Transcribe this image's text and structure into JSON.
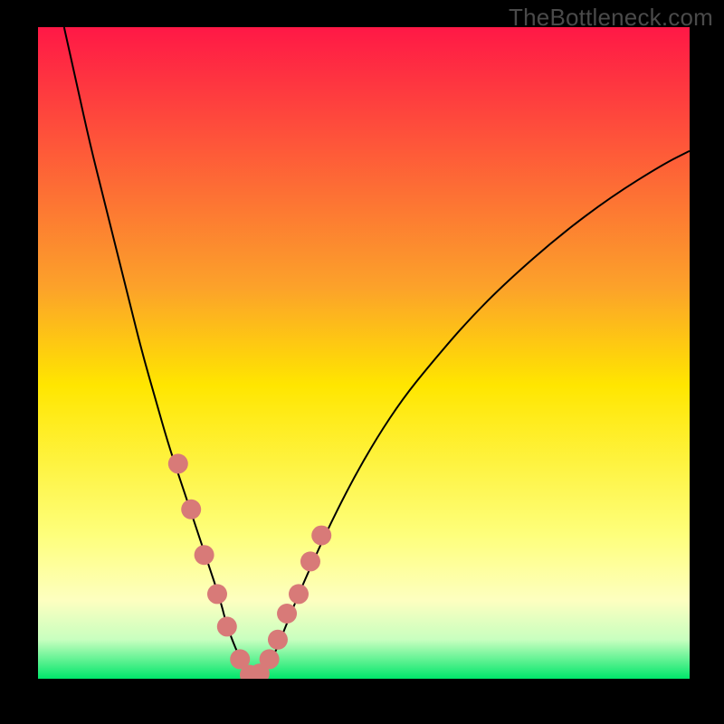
{
  "watermark": "TheBottleneck.com",
  "chart_data": {
    "type": "line",
    "title": "",
    "xlabel": "",
    "ylabel": "",
    "xlim": [
      0,
      100
    ],
    "ylim": [
      0,
      100
    ],
    "background_gradient": {
      "stops": [
        {
          "offset": 0.0,
          "color": "#ff1846"
        },
        {
          "offset": 0.4,
          "color": "#fca22a"
        },
        {
          "offset": 0.55,
          "color": "#ffe600"
        },
        {
          "offset": 0.78,
          "color": "#feff7c"
        },
        {
          "offset": 0.88,
          "color": "#fdffc0"
        },
        {
          "offset": 0.94,
          "color": "#c8ffbf"
        },
        {
          "offset": 1.0,
          "color": "#00e66a"
        }
      ]
    },
    "series": [
      {
        "name": "bottleneck-curve",
        "stroke": "#000000",
        "stroke_width": 2,
        "x": [
          4,
          6,
          8,
          10,
          12,
          14,
          16,
          18,
          20,
          22,
          24,
          26,
          28,
          29,
          31,
          32.5,
          34,
          36,
          38,
          40,
          44,
          48,
          52,
          56,
          60,
          66,
          72,
          80,
          88,
          96,
          100
        ],
        "y": [
          100,
          91,
          82,
          74,
          66,
          58,
          50,
          43,
          36,
          30,
          24,
          18,
          12,
          8,
          3,
          0.6,
          0.8,
          3,
          8,
          13,
          22,
          30,
          37,
          43,
          48,
          55,
          61,
          68,
          74,
          79,
          81
        ]
      },
      {
        "name": "highlight-dots",
        "type": "scatter",
        "fill": "#d87a78",
        "radius": 11,
        "x": [
          21.5,
          23.5,
          25.5,
          27.5,
          29.0,
          31.0,
          32.5,
          34.0,
          35.5,
          36.8,
          38.2,
          40.0,
          41.8,
          43.5
        ],
        "y": [
          33,
          26,
          19,
          13,
          8,
          3,
          0.6,
          0.8,
          3,
          6,
          10,
          13,
          18,
          22
        ],
        "note": "pink dot markers overlaid on curve near minimum; y read from same curve"
      }
    ],
    "minimum_point": {
      "x": 32.5,
      "y": 0.6
    }
  }
}
